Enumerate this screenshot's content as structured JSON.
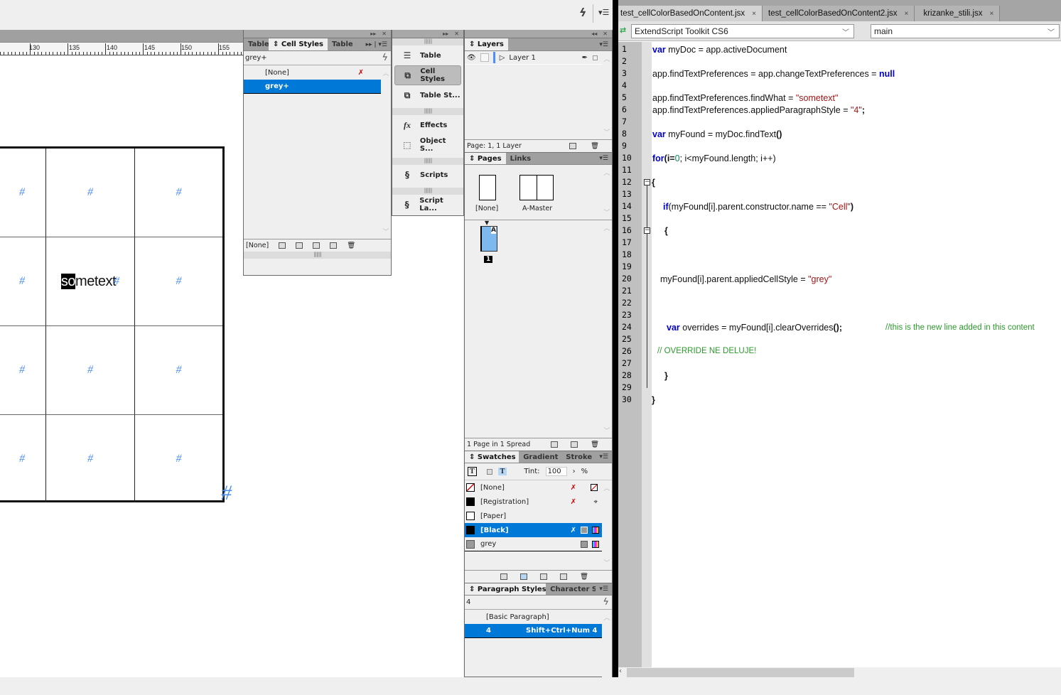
{
  "app_toolbar": {
    "lightning_icon": "quick-apply",
    "menu_icon": "panel-menu"
  },
  "ruler": {
    "labels": [
      "130",
      "135",
      "140",
      "145",
      "150",
      "155"
    ]
  },
  "document": {
    "table": {
      "rows": [
        [
          "#",
          "#",
          "#"
        ],
        [
          "#",
          "sometext#",
          "#"
        ],
        [
          "#",
          "#",
          "#"
        ],
        [
          "#",
          "#",
          "#"
        ]
      ],
      "found_text": "sometext",
      "found_text_selected": "so",
      "found_text_rest": "metext",
      "end_marker": "#",
      "overflow_marker": "#"
    }
  },
  "cell_styles_panel": {
    "tabs": [
      "Table",
      "Cell Styles",
      "Table S"
    ],
    "active_tab": "Cell Styles",
    "current_style": "grey+",
    "items": [
      {
        "label": "[None]",
        "selected": false
      },
      {
        "label": "grey+",
        "selected": true
      }
    ],
    "footer_label": "[None]"
  },
  "collapsed_dock": {
    "items": [
      {
        "label": "Table",
        "icon": "table-icon",
        "active": false
      },
      {
        "label": "Cell Styles",
        "icon": "cell-styles-icon",
        "active": true
      },
      {
        "label": "Table St...",
        "icon": "table-styles-icon",
        "active": false
      },
      {
        "label": "Effects",
        "icon": "fx-icon",
        "active": false
      },
      {
        "label": "Object S...",
        "icon": "object-styles-icon",
        "active": false
      },
      {
        "label": "Scripts",
        "icon": "scripts-icon",
        "active": false
      },
      {
        "label": "Script La...",
        "icon": "script-label-icon",
        "active": false
      }
    ]
  },
  "layers_panel": {
    "tab": "Layers",
    "layers": [
      {
        "name": "Layer 1",
        "color": "#4f8ef7"
      }
    ],
    "status": "Page: 1, 1 Layer"
  },
  "pages_panel": {
    "tabs": [
      "Pages",
      "Links"
    ],
    "masters": [
      "[None]",
      "A-Master"
    ],
    "page_number": "1",
    "page_master_prefix": "A",
    "status": "1 Page in 1 Spread"
  },
  "swatches_panel": {
    "tabs": [
      "Swatches",
      "Gradient",
      "Stroke"
    ],
    "tint_label": "Tint:",
    "tint_value": "100",
    "tint_unit": "%",
    "swatches": [
      {
        "name": "[None]",
        "color": "none",
        "selected": false
      },
      {
        "name": "[Registration]",
        "color": "#000000",
        "selected": false
      },
      {
        "name": "[Paper]",
        "color": "#ffffff",
        "selected": false
      },
      {
        "name": "[Black]",
        "color": "#000000",
        "selected": true
      },
      {
        "name": "grey",
        "color": "#9a9a9a",
        "selected": false
      }
    ]
  },
  "paragraph_styles_panel": {
    "tabs": [
      "Paragraph Styles",
      "Character Sty"
    ],
    "current_style": "4",
    "items": [
      {
        "label": "[Basic Paragraph]",
        "shortcut": "",
        "selected": false
      },
      {
        "label": "4",
        "shortcut": "Shift+Ctrl+Num 4",
        "selected": true
      }
    ]
  },
  "estk": {
    "tabs": [
      {
        "label": "test_cellColorBasedOnContent.jsx",
        "active": true
      },
      {
        "label": "test_cellColorBasedOnContent2.jsx",
        "active": false
      },
      {
        "label": "krizanke_stili.jsx",
        "active": false
      }
    ],
    "close_glyph": "×",
    "target_app": "ExtendScript Toolkit CS6",
    "function_select": "main",
    "line_numbers": [
      "1",
      "2",
      "3",
      "4",
      "5",
      "6",
      "7",
      "8",
      "9",
      "10",
      "11",
      "12",
      "13",
      "14",
      "15",
      "16",
      "17",
      "18",
      "19",
      "20",
      "21",
      "22",
      "23",
      "24",
      "25",
      "26",
      "27",
      "28",
      "29",
      "30"
    ],
    "code": {
      "l1_kw": "var",
      "l1_rest": " myDoc = app.activeDocument",
      "l3_a": "app.findTextPreferences = app.changeTextPreferences = ",
      "l3_kw": "null",
      "l5_a": "app.findTextPreferences.findWhat = ",
      "l5_str": "\"sometext\"",
      "l6_a": "app.findTextPreferences.appliedParagraphStyle = ",
      "l6_str": "\"4\"",
      "l6_end": ";",
      "l8_kw": "var",
      "l8_a": " myFound = myDoc.findText",
      "l8_p": "()",
      "l10_kw": "for",
      "l10_a": "(i=",
      "l10_num": "0",
      "l10_b": "; i<myFound.length; i++)",
      "l12": "{",
      "l14_kw": "if",
      "l14_a": "(myFound[i].parent.constructor.name == ",
      "l14_str": "\"Cell\"",
      "l14_b": ")",
      "l16": "{",
      "l20_a": "myFound[i].parent.appliedCellStyle = ",
      "l20_str": "\"grey\"",
      "l24_kw": "var",
      "l24_a": " overrides = myFound[i].clearOverrides",
      "l24_p": "();",
      "l24_cm": "//this is the new line added in this content",
      "l26_cm": "// OVERRIDE NE DELUJE!",
      "l28": "}",
      "l30": "}"
    }
  }
}
